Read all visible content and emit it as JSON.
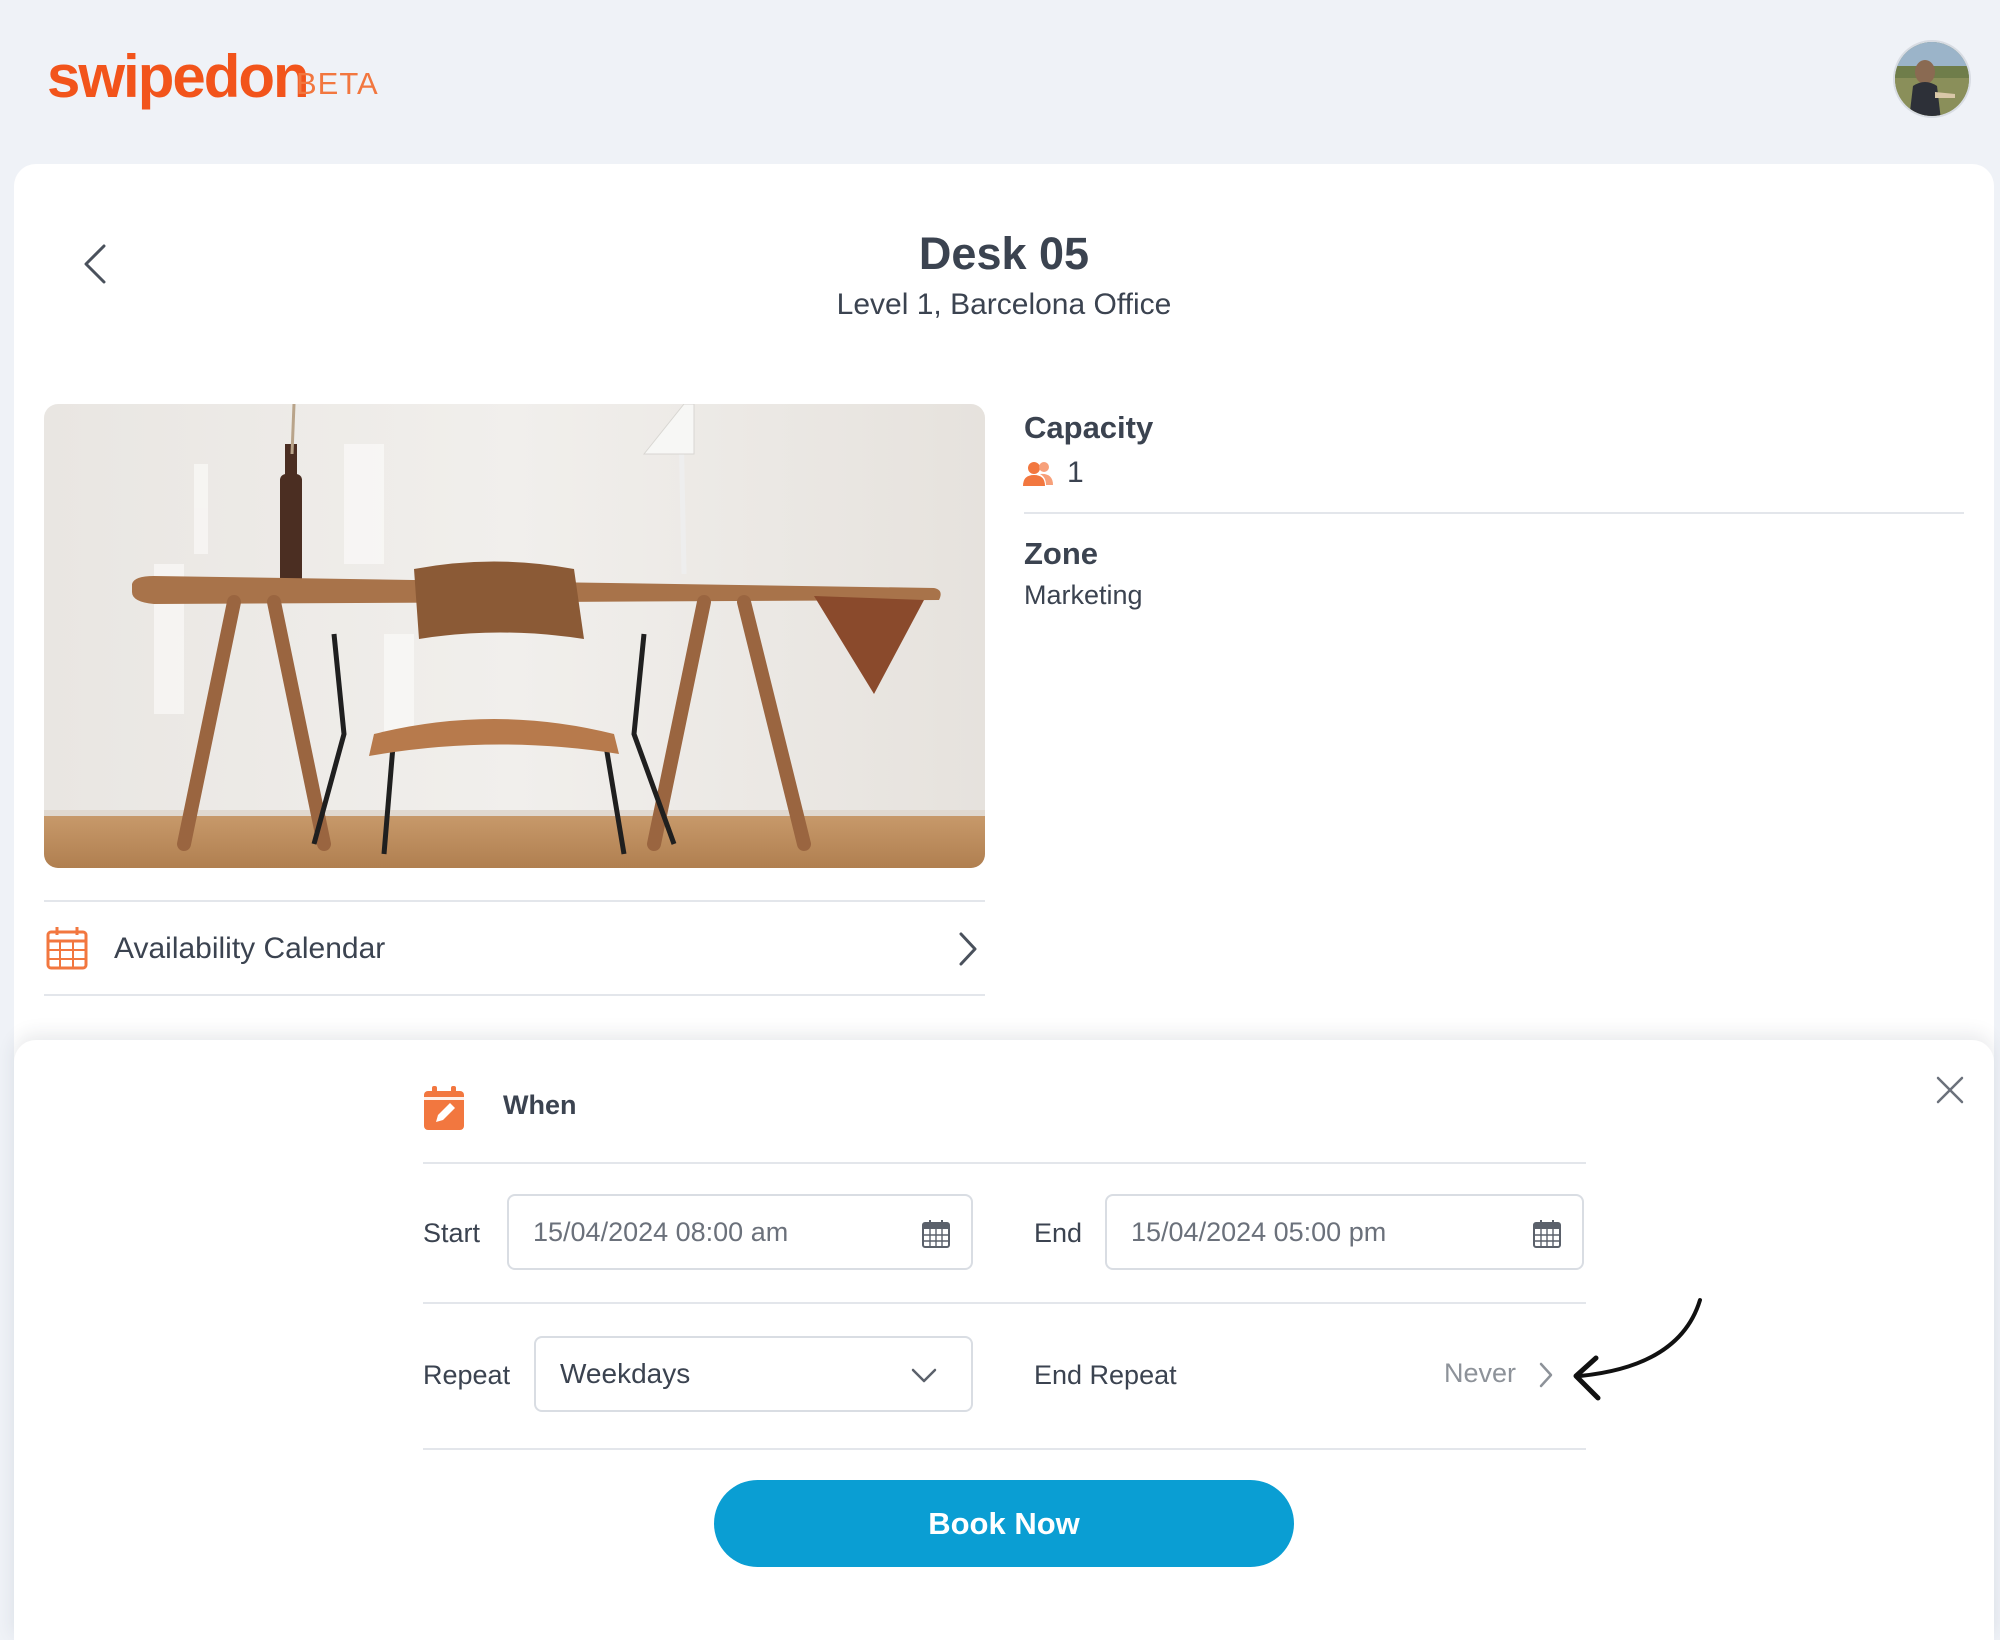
{
  "header": {
    "logo_text": "swipedon",
    "beta_label": "BETA"
  },
  "desk": {
    "title": "Desk 05",
    "location": "Level 1, Barcelona Office"
  },
  "details": {
    "capacity_label": "Capacity",
    "capacity_icon": "people-icon",
    "capacity_value": "1",
    "zone_label": "Zone",
    "zone_value": "Marketing"
  },
  "availability": {
    "label": "Availability Calendar",
    "icon": "calendar-icon"
  },
  "booking": {
    "section_label": "When",
    "start_label": "Start",
    "start_value": "15/04/2024 08:00 am",
    "end_label": "End",
    "end_value": "15/04/2024 05:00 pm",
    "repeat_label": "Repeat",
    "repeat_value": "Weekdays",
    "end_repeat_label": "End Repeat",
    "end_repeat_value": "Never",
    "book_button": "Book Now"
  },
  "colors": {
    "brand_orange": "#f2541b",
    "accent_orange": "#f2773f",
    "primary_blue": "#0a9ed3",
    "background": "#eff2f7"
  }
}
